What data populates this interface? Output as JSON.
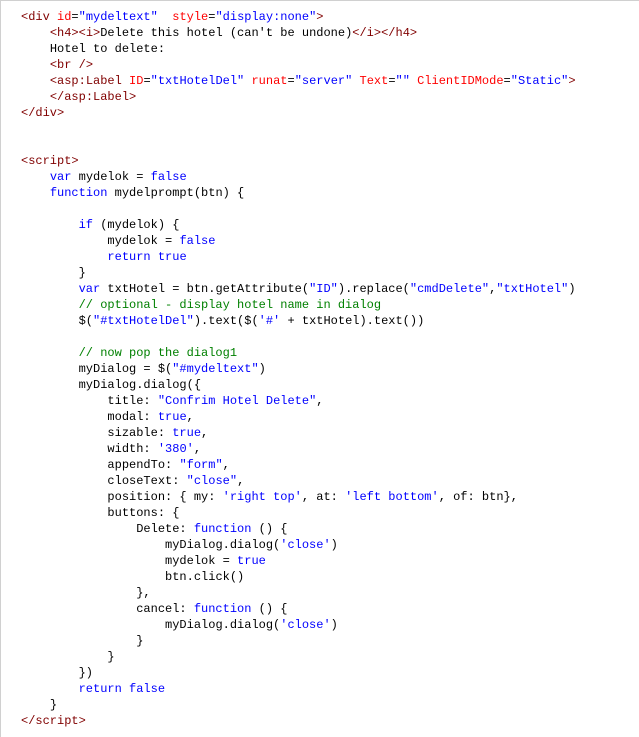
{
  "lines": [
    {
      "indent": 0,
      "spans": [
        {
          "c": "tag",
          "t": "<div"
        },
        {
          "c": "txt",
          "t": " "
        },
        {
          "c": "attr",
          "t": "id"
        },
        {
          "c": "txt",
          "t": "="
        },
        {
          "c": "str",
          "t": "\"mydeltext\""
        },
        {
          "c": "txt",
          "t": "  "
        },
        {
          "c": "attr",
          "t": "style"
        },
        {
          "c": "txt",
          "t": "="
        },
        {
          "c": "str",
          "t": "\"display:none\""
        },
        {
          "c": "tag",
          "t": ">"
        }
      ]
    },
    {
      "indent": 1,
      "spans": [
        {
          "c": "tag",
          "t": "<h4><i>"
        },
        {
          "c": "txt",
          "t": "Delete this hotel (can't be undone)"
        },
        {
          "c": "tag",
          "t": "</i></h4>"
        }
      ]
    },
    {
      "indent": 1,
      "spans": [
        {
          "c": "txt",
          "t": "Hotel to delete:"
        }
      ]
    },
    {
      "indent": 1,
      "spans": [
        {
          "c": "tag",
          "t": "<br />"
        }
      ]
    },
    {
      "indent": 1,
      "spans": [
        {
          "c": "tag",
          "t": "<asp:Label"
        },
        {
          "c": "txt",
          "t": " "
        },
        {
          "c": "attr",
          "t": "ID"
        },
        {
          "c": "txt",
          "t": "="
        },
        {
          "c": "str",
          "t": "\"txtHotelDel\""
        },
        {
          "c": "txt",
          "t": " "
        },
        {
          "c": "attr",
          "t": "runat"
        },
        {
          "c": "txt",
          "t": "="
        },
        {
          "c": "str",
          "t": "\"server\""
        },
        {
          "c": "txt",
          "t": " "
        },
        {
          "c": "attr",
          "t": "Text"
        },
        {
          "c": "txt",
          "t": "="
        },
        {
          "c": "str",
          "t": "\"\""
        },
        {
          "c": "txt",
          "t": " "
        },
        {
          "c": "attr",
          "t": "ClientIDMode"
        },
        {
          "c": "txt",
          "t": "="
        },
        {
          "c": "str",
          "t": "\"Static\""
        },
        {
          "c": "tag",
          "t": ">"
        }
      ]
    },
    {
      "indent": 1,
      "spans": [
        {
          "c": "tag",
          "t": "</asp:Label>"
        }
      ]
    },
    {
      "indent": 0,
      "spans": [
        {
          "c": "tag",
          "t": "</div>"
        }
      ]
    },
    {
      "indent": 0,
      "spans": []
    },
    {
      "indent": 0,
      "spans": []
    },
    {
      "indent": 0,
      "spans": [
        {
          "c": "tag",
          "t": "<script>"
        }
      ]
    },
    {
      "indent": 1,
      "spans": [
        {
          "c": "kw",
          "t": "var"
        },
        {
          "c": "txt",
          "t": " mydelok = "
        },
        {
          "c": "kw",
          "t": "false"
        }
      ]
    },
    {
      "indent": 1,
      "spans": [
        {
          "c": "kw",
          "t": "function"
        },
        {
          "c": "txt",
          "t": " mydelprompt(btn) {"
        }
      ]
    },
    {
      "indent": 0,
      "spans": []
    },
    {
      "indent": 2,
      "spans": [
        {
          "c": "kw",
          "t": "if"
        },
        {
          "c": "txt",
          "t": " (mydelok) {"
        }
      ]
    },
    {
      "indent": 3,
      "spans": [
        {
          "c": "txt",
          "t": "mydelok = "
        },
        {
          "c": "kw",
          "t": "false"
        }
      ]
    },
    {
      "indent": 3,
      "spans": [
        {
          "c": "kw",
          "t": "return"
        },
        {
          "c": "txt",
          "t": " "
        },
        {
          "c": "kw",
          "t": "true"
        }
      ]
    },
    {
      "indent": 2,
      "spans": [
        {
          "c": "txt",
          "t": "}"
        }
      ]
    },
    {
      "indent": 2,
      "spans": [
        {
          "c": "kw",
          "t": "var"
        },
        {
          "c": "txt",
          "t": " txtHotel = btn.getAttribute("
        },
        {
          "c": "str",
          "t": "\"ID\""
        },
        {
          "c": "txt",
          "t": ").replace("
        },
        {
          "c": "str",
          "t": "\"cmdDelete\""
        },
        {
          "c": "txt",
          "t": ","
        },
        {
          "c": "str",
          "t": "\"txtHotel\""
        },
        {
          "c": "txt",
          "t": ")"
        }
      ]
    },
    {
      "indent": 2,
      "spans": [
        {
          "c": "cmt",
          "t": "// optional - display hotel name in dialog"
        }
      ]
    },
    {
      "indent": 2,
      "spans": [
        {
          "c": "txt",
          "t": "$("
        },
        {
          "c": "str",
          "t": "\"#txtHotelDel\""
        },
        {
          "c": "txt",
          "t": ").text($("
        },
        {
          "c": "str",
          "t": "'#'"
        },
        {
          "c": "txt",
          "t": " + txtHotel).text())"
        }
      ]
    },
    {
      "indent": 0,
      "spans": []
    },
    {
      "indent": 2,
      "spans": [
        {
          "c": "cmt",
          "t": "// now pop the dialog1"
        }
      ]
    },
    {
      "indent": 2,
      "spans": [
        {
          "c": "txt",
          "t": "myDialog = $("
        },
        {
          "c": "str",
          "t": "\"#mydeltext\""
        },
        {
          "c": "txt",
          "t": ")"
        }
      ]
    },
    {
      "indent": 2,
      "spans": [
        {
          "c": "txt",
          "t": "myDialog.dialog({"
        }
      ]
    },
    {
      "indent": 3,
      "spans": [
        {
          "c": "txt",
          "t": "title: "
        },
        {
          "c": "str",
          "t": "\"Confrim Hotel Delete\""
        },
        {
          "c": "txt",
          "t": ","
        }
      ]
    },
    {
      "indent": 3,
      "spans": [
        {
          "c": "txt",
          "t": "modal: "
        },
        {
          "c": "kw",
          "t": "true"
        },
        {
          "c": "txt",
          "t": ","
        }
      ]
    },
    {
      "indent": 3,
      "spans": [
        {
          "c": "txt",
          "t": "sizable: "
        },
        {
          "c": "kw",
          "t": "true"
        },
        {
          "c": "txt",
          "t": ","
        }
      ]
    },
    {
      "indent": 3,
      "spans": [
        {
          "c": "txt",
          "t": "width: "
        },
        {
          "c": "str",
          "t": "'380'"
        },
        {
          "c": "txt",
          "t": ","
        }
      ]
    },
    {
      "indent": 3,
      "spans": [
        {
          "c": "txt",
          "t": "appendTo: "
        },
        {
          "c": "str",
          "t": "\"form\""
        },
        {
          "c": "txt",
          "t": ","
        }
      ]
    },
    {
      "indent": 3,
      "spans": [
        {
          "c": "txt",
          "t": "closeText: "
        },
        {
          "c": "str",
          "t": "\"close\""
        },
        {
          "c": "txt",
          "t": ","
        }
      ]
    },
    {
      "indent": 3,
      "spans": [
        {
          "c": "txt",
          "t": "position: { my: "
        },
        {
          "c": "str",
          "t": "'right top'"
        },
        {
          "c": "txt",
          "t": ", at: "
        },
        {
          "c": "str",
          "t": "'left bottom'"
        },
        {
          "c": "txt",
          "t": ", of: btn},"
        }
      ]
    },
    {
      "indent": 3,
      "spans": [
        {
          "c": "txt",
          "t": "buttons: {"
        }
      ]
    },
    {
      "indent": 4,
      "spans": [
        {
          "c": "txt",
          "t": "Delete: "
        },
        {
          "c": "kw",
          "t": "function"
        },
        {
          "c": "txt",
          "t": " () {"
        }
      ]
    },
    {
      "indent": 5,
      "spans": [
        {
          "c": "txt",
          "t": "myDialog.dialog("
        },
        {
          "c": "str",
          "t": "'close'"
        },
        {
          "c": "txt",
          "t": ")"
        }
      ]
    },
    {
      "indent": 5,
      "spans": [
        {
          "c": "txt",
          "t": "mydelok = "
        },
        {
          "c": "kw",
          "t": "true"
        }
      ]
    },
    {
      "indent": 5,
      "spans": [
        {
          "c": "txt",
          "t": "btn.click()"
        }
      ]
    },
    {
      "indent": 4,
      "spans": [
        {
          "c": "txt",
          "t": "},"
        }
      ]
    },
    {
      "indent": 4,
      "spans": [
        {
          "c": "txt",
          "t": "cancel: "
        },
        {
          "c": "kw",
          "t": "function"
        },
        {
          "c": "txt",
          "t": " () {"
        }
      ]
    },
    {
      "indent": 5,
      "spans": [
        {
          "c": "txt",
          "t": "myDialog.dialog("
        },
        {
          "c": "str",
          "t": "'close'"
        },
        {
          "c": "txt",
          "t": ")"
        }
      ]
    },
    {
      "indent": 4,
      "spans": [
        {
          "c": "txt",
          "t": "}"
        }
      ]
    },
    {
      "indent": 3,
      "spans": [
        {
          "c": "txt",
          "t": "}"
        }
      ]
    },
    {
      "indent": 2,
      "spans": [
        {
          "c": "txt",
          "t": "})"
        }
      ]
    },
    {
      "indent": 2,
      "spans": [
        {
          "c": "kw",
          "t": "return"
        },
        {
          "c": "txt",
          "t": " "
        },
        {
          "c": "kw",
          "t": "false"
        }
      ]
    },
    {
      "indent": 1,
      "spans": [
        {
          "c": "txt",
          "t": "}"
        }
      ]
    },
    {
      "indent": 0,
      "spans": [
        {
          "c": "tag",
          "t": "</script>"
        }
      ]
    }
  ],
  "indentUnit": "    "
}
